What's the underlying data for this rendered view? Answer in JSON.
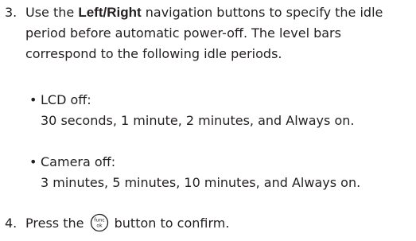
{
  "step3": {
    "number": "3.",
    "text_before": "Use the ",
    "bold": "Left/Right",
    "text_after": " navigation buttons to specify the idle period before automatic power-off. The level bars correspond to the following idle periods."
  },
  "bullets": [
    {
      "title": "LCD off:",
      "detail": "30 seconds, 1 minute, 2 minutes, and Always on."
    },
    {
      "title": "Camera off:",
      "detail": "3 minutes, 5 minutes, 10 minutes, and Always on."
    }
  ],
  "step4": {
    "number": "4.",
    "text_before": "Press the ",
    "icon": "func-ok-button-icon",
    "icon_text_top": "func",
    "icon_text_bottom": "ok",
    "text_after": " button to confirm."
  }
}
